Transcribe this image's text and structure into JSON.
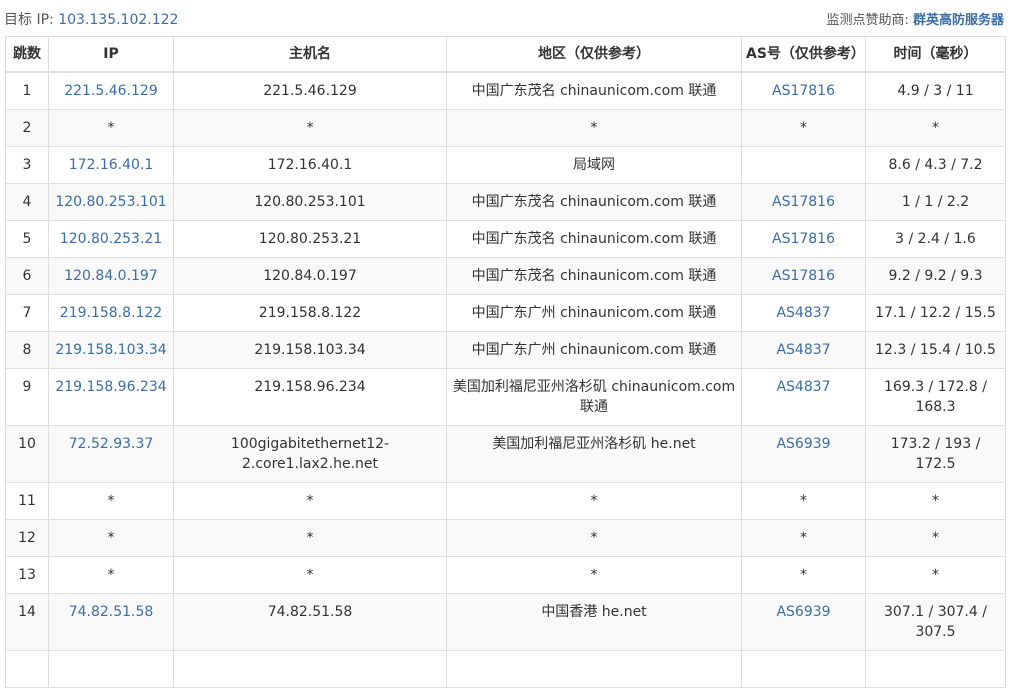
{
  "header": {
    "target_label": "目标 IP:",
    "target_ip": "103.135.102.122",
    "sponsor_label": "监测点赞助商:",
    "sponsor_name": "群英高防服务器"
  },
  "table": {
    "columns": [
      "跳数",
      "IP",
      "主机名",
      "地区（仅供参考）",
      "AS号（仅供参考）",
      "时间（毫秒）"
    ],
    "rows": [
      {
        "hop": "1",
        "ip": "221.5.46.129",
        "host": "221.5.46.129",
        "region": "中国广东茂名 chinaunicom.com 联通",
        "as": "AS17816",
        "time": "4.9 / 3 / 11"
      },
      {
        "hop": "2",
        "ip": "*",
        "host": "*",
        "region": "*",
        "as": "*",
        "time": "*"
      },
      {
        "hop": "3",
        "ip": "172.16.40.1",
        "host": "172.16.40.1",
        "region": "局域网",
        "as": "",
        "time": "8.6 / 4.3 / 7.2"
      },
      {
        "hop": "4",
        "ip": "120.80.253.101",
        "host": "120.80.253.101",
        "region": "中国广东茂名 chinaunicom.com 联通",
        "as": "AS17816",
        "time": "1 / 1 / 2.2"
      },
      {
        "hop": "5",
        "ip": "120.80.253.21",
        "host": "120.80.253.21",
        "region": "中国广东茂名 chinaunicom.com 联通",
        "as": "AS17816",
        "time": "3 / 2.4 / 1.6"
      },
      {
        "hop": "6",
        "ip": "120.84.0.197",
        "host": "120.84.0.197",
        "region": "中国广东茂名 chinaunicom.com 联通",
        "as": "AS17816",
        "time": "9.2 / 9.2 / 9.3"
      },
      {
        "hop": "7",
        "ip": "219.158.8.122",
        "host": "219.158.8.122",
        "region": "中国广东广州 chinaunicom.com 联通",
        "as": "AS4837",
        "time": "17.1 / 12.2 / 15.5"
      },
      {
        "hop": "8",
        "ip": "219.158.103.34",
        "host": "219.158.103.34",
        "region": "中国广东广州 chinaunicom.com 联通",
        "as": "AS4837",
        "time": "12.3 / 15.4 / 10.5"
      },
      {
        "hop": "9",
        "ip": "219.158.96.234",
        "host": "219.158.96.234",
        "region": "美国加利福尼亚州洛杉矶 chinaunicom.com 联通",
        "as": "AS4837",
        "time": "169.3 / 172.8 / 168.3"
      },
      {
        "hop": "10",
        "ip": "72.52.93.37",
        "host": "100gigabitethernet12-2.core1.lax2.he.net",
        "region": "美国加利福尼亚州洛杉矶 he.net",
        "as": "AS6939",
        "time": "173.2 / 193 / 172.5"
      },
      {
        "hop": "11",
        "ip": "*",
        "host": "*",
        "region": "*",
        "as": "*",
        "time": "*"
      },
      {
        "hop": "12",
        "ip": "*",
        "host": "*",
        "region": "*",
        "as": "*",
        "time": "*"
      },
      {
        "hop": "13",
        "ip": "*",
        "host": "*",
        "region": "*",
        "as": "*",
        "time": "*"
      },
      {
        "hop": "14",
        "ip": "74.82.51.58",
        "host": "74.82.51.58",
        "region": "中国香港 he.net",
        "as": "AS6939",
        "time": "307.1 / 307.4 / 307.5"
      },
      {
        "hop": "",
        "ip": "",
        "host": "",
        "region": "",
        "as": "",
        "time": ""
      }
    ]
  },
  "colors": {
    "link": "#3a6ea5",
    "border": "#dedede",
    "stripe": "#f9f9f9"
  }
}
